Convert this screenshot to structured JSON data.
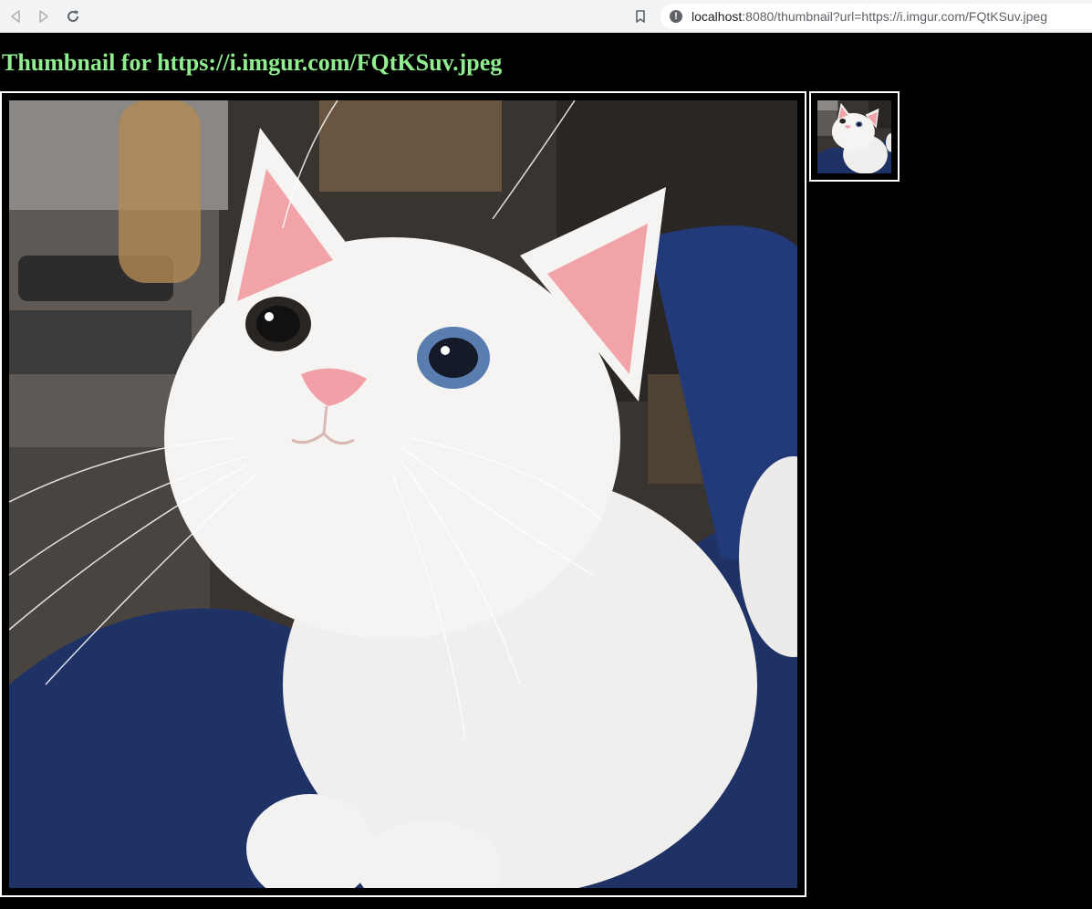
{
  "browser": {
    "url_host": "localhost",
    "url_rest": ":8080/thumbnail?url=https://i.imgur.com/FQtKSuv.jpeg",
    "icons": {
      "back": "back-arrow-icon",
      "forward": "forward-arrow-icon",
      "reload": "reload-icon",
      "bookmark": "bookmark-icon",
      "site_info": "info-icon"
    }
  },
  "page": {
    "title": "Thumbnail for https://i.imgur.com/FQtKSuv.jpeg",
    "title_color": "#90ee90",
    "background": "#000000",
    "border_color": "#ffffff"
  },
  "images": [
    {
      "name": "large-thumbnail",
      "subject": "white kitten looking up on blue blanket"
    },
    {
      "name": "small-thumbnail",
      "subject": "white kitten looking up on blue blanket"
    }
  ]
}
